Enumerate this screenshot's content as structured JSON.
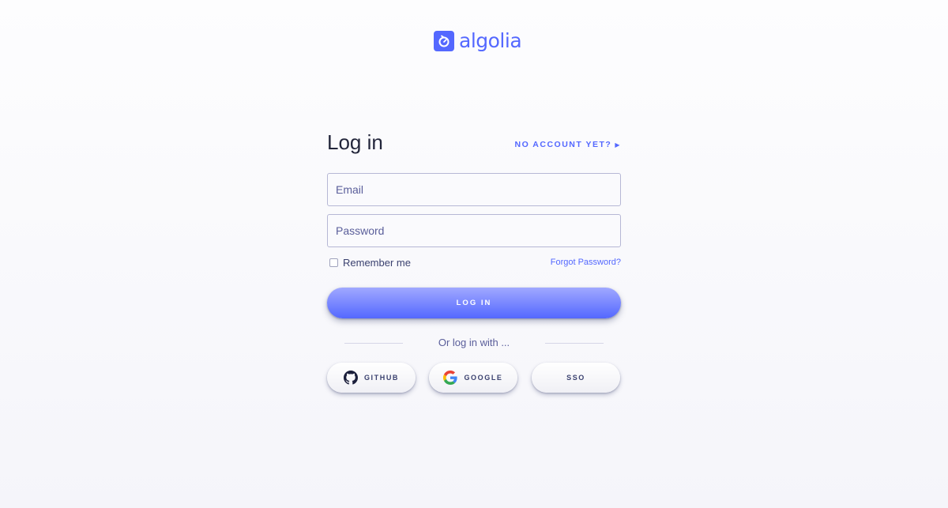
{
  "brand": {
    "name": "algolia",
    "color": "#5468ff",
    "logo_icon": "stopwatch-icon"
  },
  "login": {
    "title": "Log in",
    "no_account_link": "NO ACCOUNT YET?",
    "no_account_arrow": "▶",
    "email_placeholder": "Email",
    "email_value": "",
    "password_placeholder": "Password",
    "password_value": "",
    "remember_label": "Remember me",
    "remember_checked": false,
    "forgot_link": "Forgot Password?",
    "submit_label": "LOG IN",
    "divider_text": "Or log in with ..."
  },
  "social": {
    "github_label": "GITHUB",
    "github_icon": "github-icon",
    "google_label": "GOOGLE",
    "google_icon": "google-icon",
    "sso_label": "SSO"
  },
  "colors": {
    "accent": "#5468ff",
    "text_dark": "#23263b",
    "text_muted": "#5a5e9a",
    "border": "#b6b7d5"
  }
}
